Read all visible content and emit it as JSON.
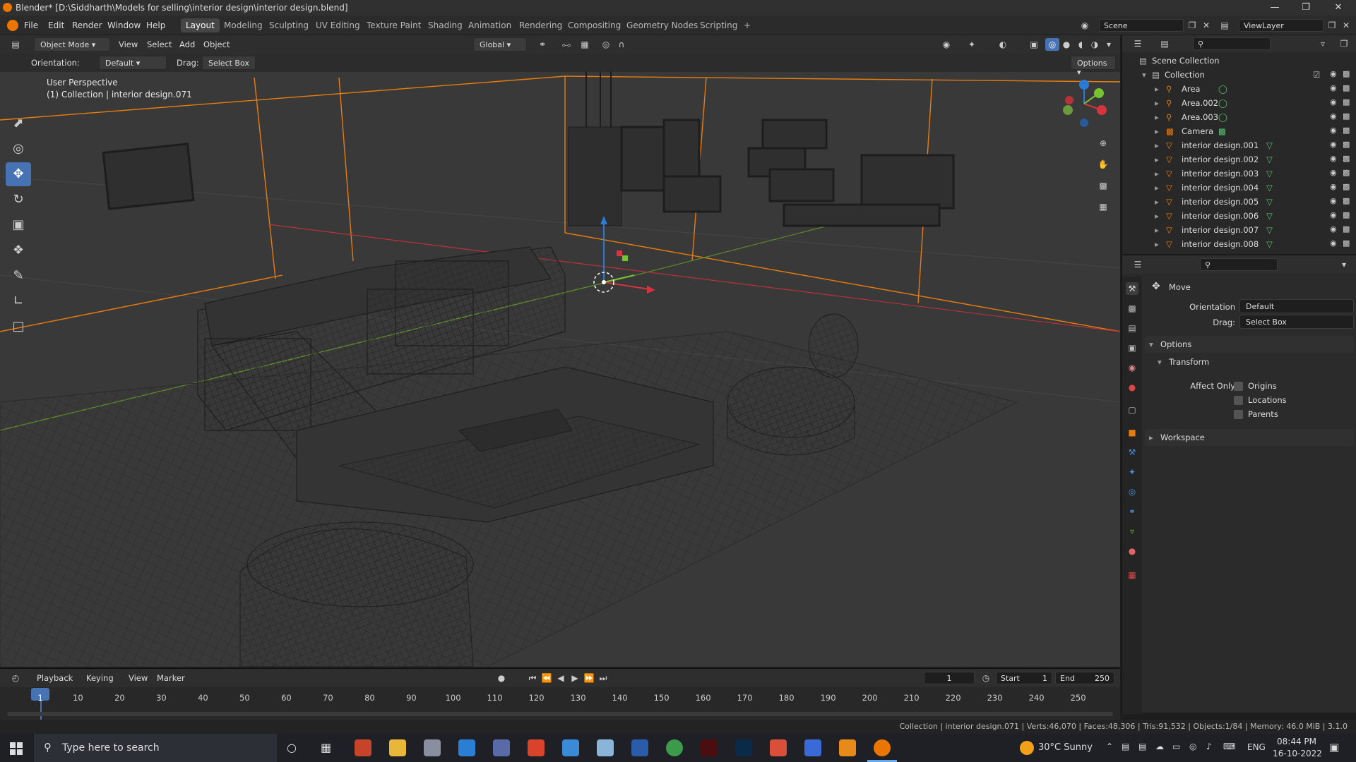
{
  "titlebar": {
    "title": "Blender* [D:\\Siddharth\\Models for selling\\interior design\\interior design.blend]"
  },
  "menu": {
    "items": [
      "File",
      "Edit",
      "Render",
      "Window",
      "Help"
    ]
  },
  "workspaces": [
    "Layout",
    "Modeling",
    "Sculpting",
    "UV Editing",
    "Texture Paint",
    "Shading",
    "Animation",
    "Rendering",
    "Compositing",
    "Geometry Nodes",
    "Scripting",
    "+"
  ],
  "active_workspace": "Layout",
  "scene": {
    "label": "Scene",
    "viewlayer": "ViewLayer"
  },
  "viewport_header": {
    "mode": "Object Mode",
    "menus": [
      "View",
      "Select",
      "Add",
      "Object"
    ],
    "transform": "Global",
    "orientation_label": "Orientation:",
    "orientation_value": "Default",
    "drag_label": "Drag:",
    "drag_value": "Select Box",
    "options": "Options"
  },
  "viewport": {
    "perspective": "User Perspective",
    "collection_info": "(1) Collection | interior design.071"
  },
  "outliner": {
    "scene_collection": "Scene Collection",
    "collection": "Collection",
    "items": [
      "Area",
      "Area.002",
      "Area.003",
      "Camera",
      "interior design.001",
      "interior design.002",
      "interior design.003",
      "interior design.004",
      "interior design.005",
      "interior design.006",
      "interior design.007",
      "interior design.008"
    ]
  },
  "properties": {
    "tool_name": "Move",
    "orientation_label": "Orientation",
    "orientation_value": "Default",
    "drag_label": "Drag:",
    "drag_value": "Select Box",
    "options_label": "Options",
    "transform_label": "Transform",
    "affect_only_label": "Affect Only",
    "affect_items": [
      "Origins",
      "Locations",
      "Parents"
    ],
    "workspace_label": "Workspace"
  },
  "timeline": {
    "menus": [
      "Playback",
      "Keying",
      "View",
      "Marker"
    ],
    "current_frame": "1",
    "start_label": "Start",
    "start_value": "1",
    "end_label": "End",
    "end_value": "250",
    "ticks": [
      "1",
      "10",
      "20",
      "30",
      "40",
      "50",
      "60",
      "70",
      "80",
      "90",
      "100",
      "110",
      "120",
      "130",
      "140",
      "150",
      "160",
      "170",
      "180",
      "190",
      "200",
      "210",
      "220",
      "230",
      "240",
      "250"
    ]
  },
  "status": {
    "text": "Collection | interior design.071 | Verts:46,070 | Faces:48,306 | Tris:91,532 | Objects:1/84 | Memory: 46.0 MiB | 3.1.0"
  },
  "taskbar": {
    "search_placeholder": "Type here to search",
    "weather": "30°C  Sunny",
    "lang": "ENG",
    "time": "08:44 PM",
    "date": "16-10-2022"
  },
  "colors": {
    "accent": "#4772b3",
    "orange": "#e87d0d",
    "blender_orange": "#ea7600"
  }
}
